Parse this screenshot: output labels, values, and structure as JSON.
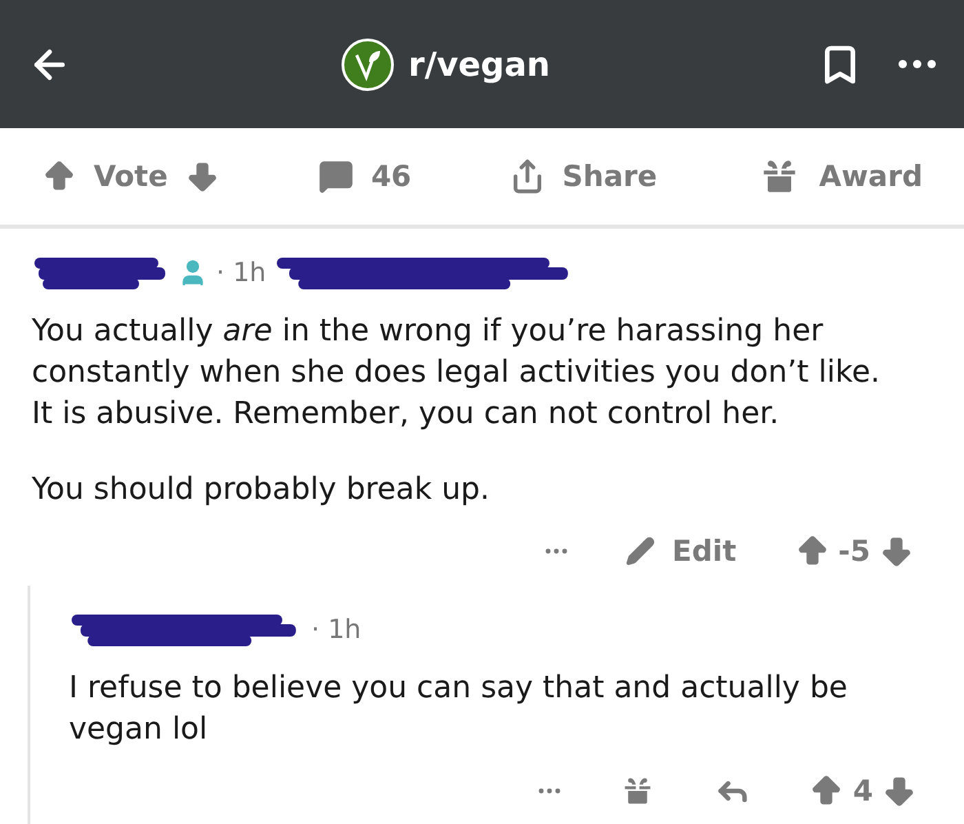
{
  "header": {
    "subreddit": "r/vegan"
  },
  "post_actions": [
    {
      "kind": "vote",
      "label": "Vote"
    },
    {
      "kind": "comments",
      "label": "46"
    },
    {
      "kind": "share",
      "label": "Share"
    },
    {
      "kind": "award",
      "label": "Award"
    }
  ],
  "comments": [
    {
      "meta": "· 1h",
      "has_avatar": true,
      "paragraphs": [
        "You actually *are* in the wrong if you’re harassing her constantly when she does legal activities you don’t like. It is abusive. Remember, you can not control her.",
        "You should probably break up."
      ],
      "actions": [
        {
          "kind": "more"
        },
        {
          "kind": "edit",
          "label": "Edit"
        },
        {
          "kind": "vote",
          "label": "-5"
        }
      ],
      "children": [
        {
          "meta": "· 1h",
          "has_avatar": false,
          "paragraphs": [
            "I refuse to believe you can say that and actually be vegan lol"
          ],
          "actions": [
            {
              "kind": "more"
            },
            {
              "kind": "award"
            },
            {
              "kind": "reply"
            },
            {
              "kind": "vote",
              "label": "4"
            }
          ]
        }
      ]
    }
  ]
}
